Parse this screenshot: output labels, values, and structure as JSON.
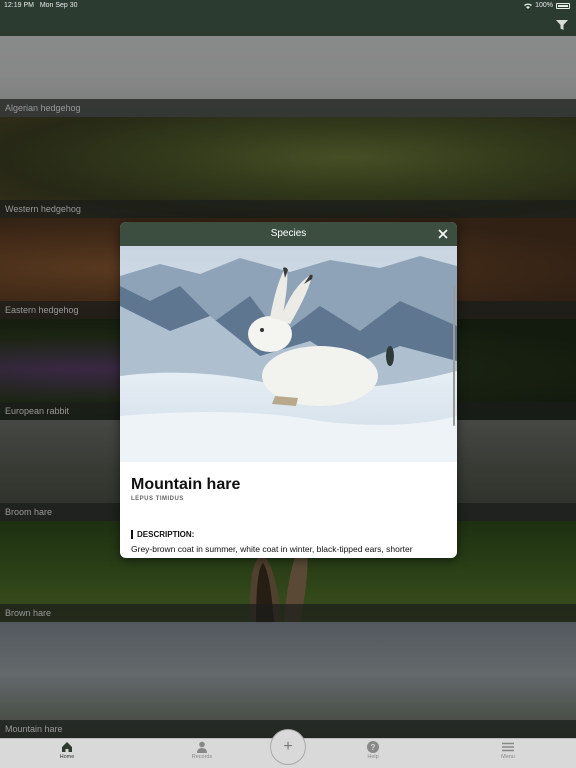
{
  "status": {
    "time": "12:19 PM",
    "date": "Mon Sep 30",
    "battery": "100%"
  },
  "list": [
    {
      "label": "Algerian hedgehog"
    },
    {
      "label": "Western hedgehog"
    },
    {
      "label": "Eastern hedgehog"
    },
    {
      "label": "European rabbit"
    },
    {
      "label": "Broom hare"
    },
    {
      "label": "Brown hare"
    },
    {
      "label": "Mountain hare"
    }
  ],
  "modal": {
    "title": "Species",
    "name": "Mountain hare",
    "latin": "LEPUS TIMIDUS",
    "description_label": "DESCRIPTION:",
    "description": "Grey-brown coat in summer, white coat in winter, black-tipped ears, shorter"
  },
  "tabs": [
    {
      "label": "Home",
      "icon": "home-icon"
    },
    {
      "label": "Records",
      "icon": "person-icon"
    },
    {
      "label": "Help",
      "icon": "help-icon"
    },
    {
      "label": "Menu",
      "icon": "menu-icon"
    }
  ],
  "fab": {
    "label": "+"
  },
  "colors": {
    "header": "#2c3b30",
    "modal_header": "#3c4e40",
    "tabbar": "#d9d9d9"
  }
}
